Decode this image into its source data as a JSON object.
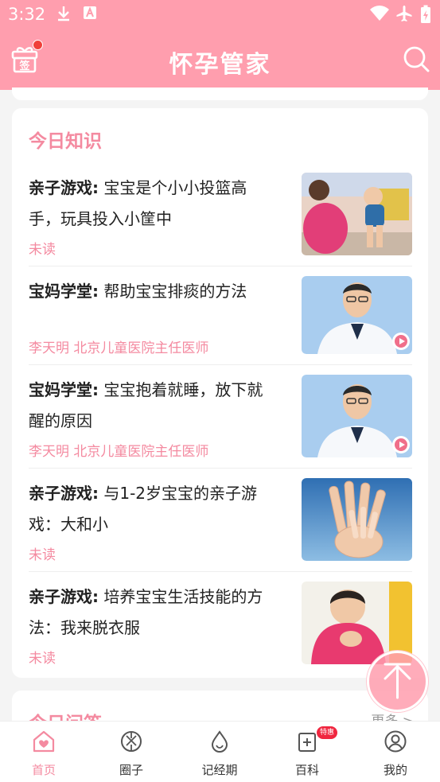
{
  "status_bar": {
    "time": "3:32"
  },
  "header": {
    "title": "怀孕管家",
    "gift_label": "签"
  },
  "knowledge": {
    "heading": "今日知识",
    "articles": [
      {
        "tag": "亲子游戏:",
        "line1": "宝宝是个小小投篮高",
        "line2": "手，玩具投入小筐中",
        "meta": "未读"
      },
      {
        "tag": "宝妈学堂:",
        "line1": "帮助宝宝排痰的方法",
        "line2": "",
        "meta": "李天明  北京儿童医院主任医师"
      },
      {
        "tag": "宝妈学堂:",
        "line1": "宝宝抱着就睡，放下就",
        "line2": "醒的原因",
        "meta": "李天明  北京儿童医院主任医师"
      },
      {
        "tag": "亲子游戏:",
        "line1": "与1-2岁宝宝的亲子游",
        "line2": "戏：大和小",
        "meta": "未读"
      },
      {
        "tag": "亲子游戏:",
        "line1": "培养宝宝生活技能的方",
        "line2": "法：我来脱衣服",
        "meta": "未读"
      }
    ]
  },
  "qa": {
    "heading": "今日问答",
    "more": "更多 >"
  },
  "tabbar": {
    "tabs": [
      {
        "label": "首页"
      },
      {
        "label": "圈子"
      },
      {
        "label": "记经期"
      },
      {
        "label": "百科",
        "badge": "特惠"
      },
      {
        "label": "我的"
      }
    ]
  },
  "colors": {
    "brand": "#ff9eae",
    "accent": "#f48aa0"
  }
}
